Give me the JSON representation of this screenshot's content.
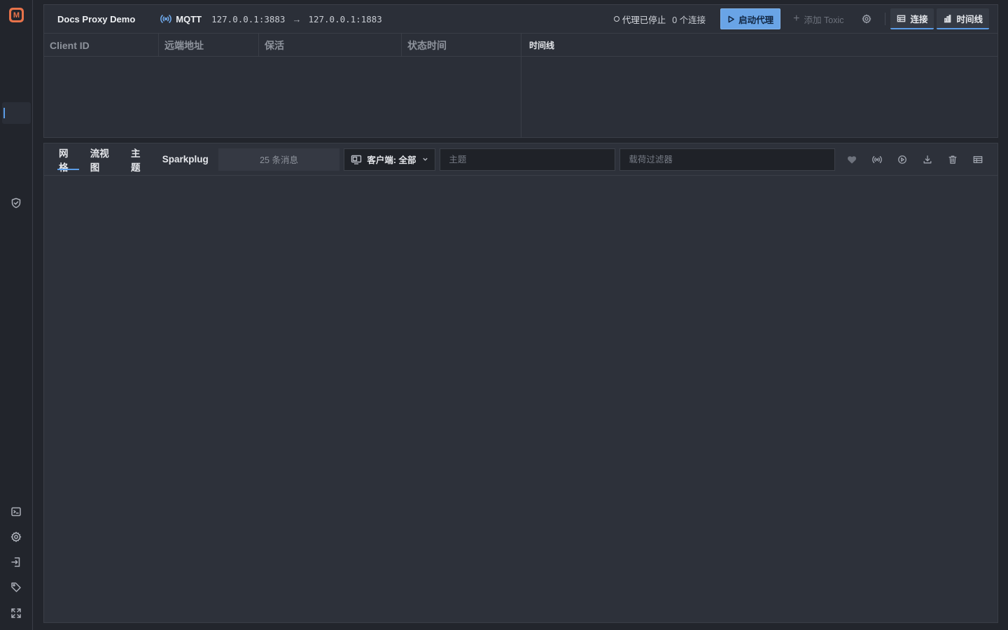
{
  "app": {
    "logo_letter": "M"
  },
  "topbar": {
    "proxy_name": "Docs Proxy Demo",
    "protocol": "MQTT",
    "listen_addr": "127.0.0.1:3883",
    "arrow": "→",
    "target_addr": "127.0.0.1:1883",
    "status_text": "代理已停止",
    "connection_count": "0 个连接",
    "start_button": "启动代理",
    "add_toxic_button": "添加 Toxic",
    "view_tabs": [
      "连接",
      "时间线"
    ]
  },
  "connections": {
    "columns": [
      "Client ID",
      "远端地址",
      "保活",
      "状态时间"
    ]
  },
  "timeline": {
    "title": "时间线"
  },
  "messages": {
    "tabs": [
      "网格",
      "流视图",
      "主题",
      "Sparkplug"
    ],
    "active_tab": "网格",
    "count_text": "25 条消息",
    "client_filter": "客户端: 全部",
    "topic_placeholder": "主题",
    "payload_placeholder": "载荷过滤器"
  },
  "colors": {
    "accent": "#5b9ce6",
    "start_button_bg": "#69a4e6",
    "logo": "#e8734a"
  }
}
